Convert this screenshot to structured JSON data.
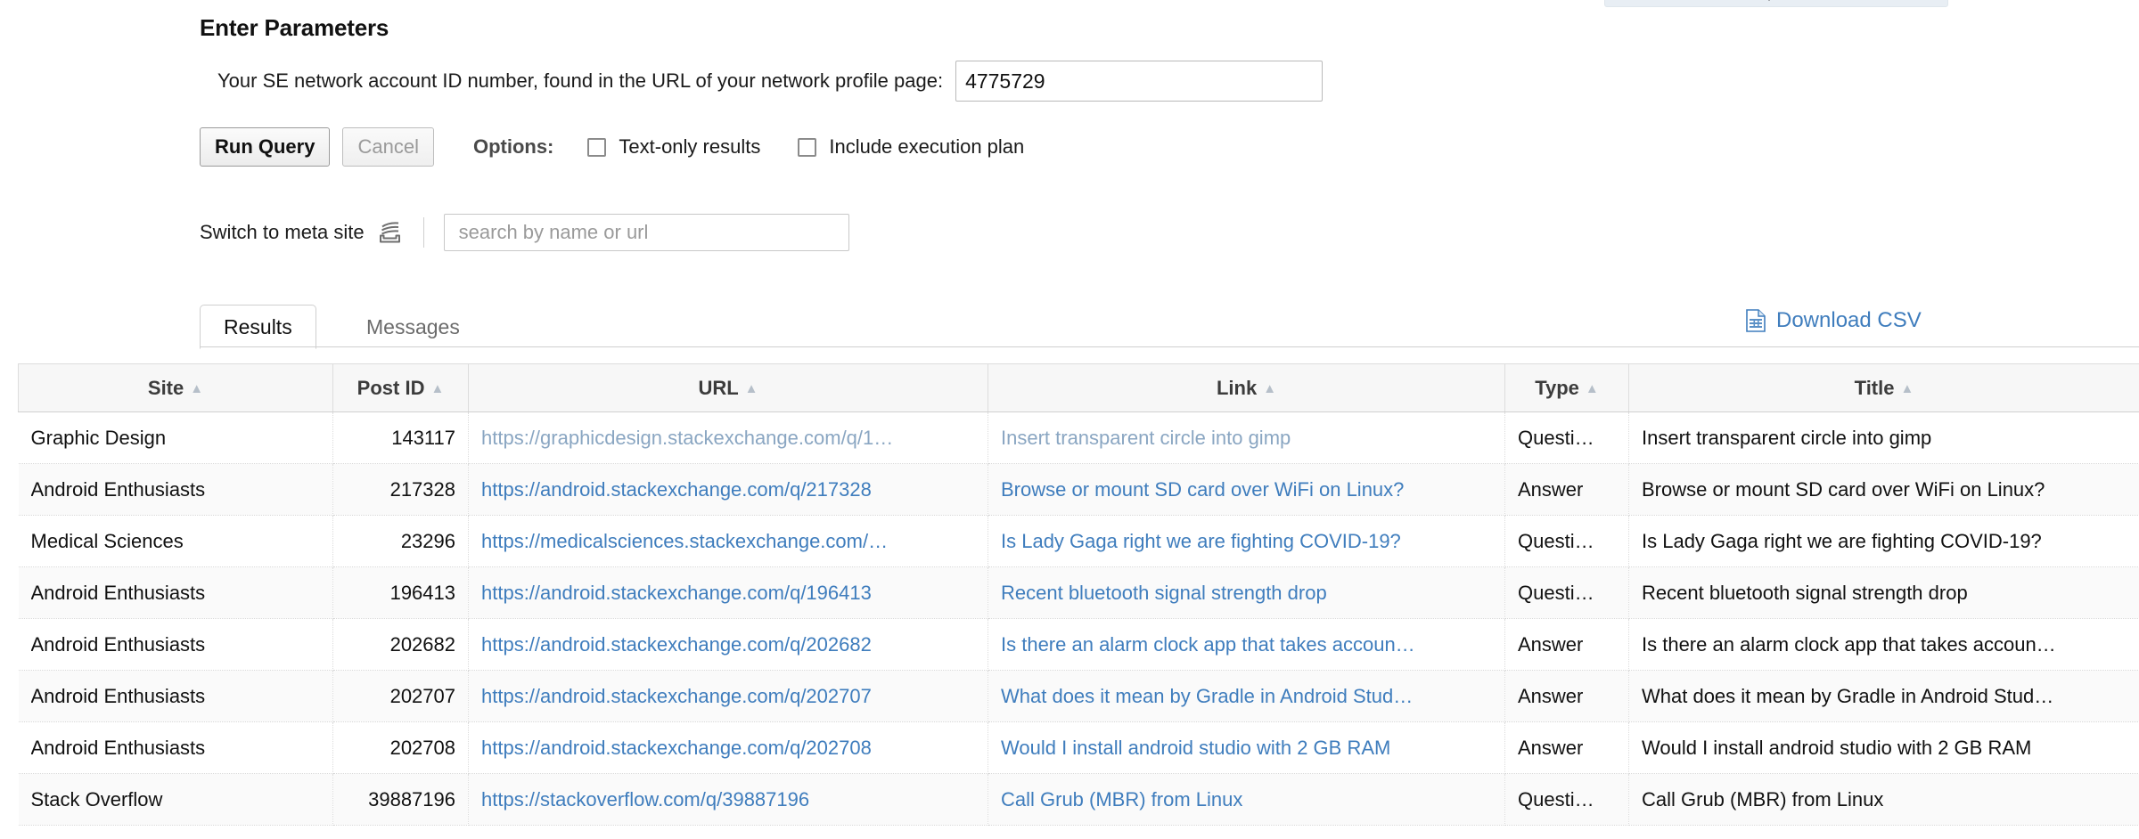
{
  "top_panel": {
    "icon": "check-glyph"
  },
  "form": {
    "heading": "Enter Parameters",
    "param_label": "Your SE network account ID number, found in the URL of your network profile page:",
    "param_value": "4775729",
    "param_placeholder": "",
    "run_label": "Run Query",
    "cancel_label": "Cancel",
    "options_label": "Options:",
    "option_text_only": "Text-only results",
    "option_exec_plan": "Include execution plan"
  },
  "meta": {
    "switch_label": "Switch to meta site",
    "icon": "stack-exchange-icon",
    "search_placeholder": "search by name or url",
    "search_value": ""
  },
  "tabs": {
    "items": [
      {
        "label": "Results",
        "active": true
      },
      {
        "label": "Messages",
        "active": false
      }
    ],
    "download_label": "Download CSV",
    "download_icon": "csv-file-icon"
  },
  "table": {
    "columns": [
      {
        "label": "Site",
        "sort": "▲"
      },
      {
        "label": "Post ID",
        "sort": "▲"
      },
      {
        "label": "URL",
        "sort": "▲"
      },
      {
        "label": "Link",
        "sort": "▲"
      },
      {
        "label": "Type",
        "sort": "▲"
      },
      {
        "label": "Title",
        "sort": "▲"
      }
    ],
    "rows": [
      {
        "site": "Graphic Design",
        "post_id": "143117",
        "url": "https://graphicdesign.stackexchange.com/q/1…",
        "url_visited": true,
        "link": "Insert transparent circle into gimp",
        "link_visited": true,
        "type": "Questi…",
        "title": "Insert transparent circle into gimp"
      },
      {
        "site": "Android Enthusiasts",
        "post_id": "217328",
        "url": "https://android.stackexchange.com/q/217328",
        "url_visited": false,
        "link": "Browse or mount SD card over WiFi on Linux?",
        "link_visited": false,
        "type": "Answer",
        "title": "Browse or mount SD card over WiFi on Linux?"
      },
      {
        "site": "Medical Sciences",
        "post_id": "23296",
        "url": "https://medicalsciences.stackexchange.com/…",
        "url_visited": false,
        "link": "Is Lady Gaga right we are fighting COVID-19?",
        "link_visited": false,
        "type": "Questi…",
        "title": "Is Lady Gaga right we are fighting COVID-19?"
      },
      {
        "site": "Android Enthusiasts",
        "post_id": "196413",
        "url": "https://android.stackexchange.com/q/196413",
        "url_visited": false,
        "link": "Recent bluetooth signal strength drop",
        "link_visited": false,
        "type": "Questi…",
        "title": "Recent bluetooth signal strength drop"
      },
      {
        "site": "Android Enthusiasts",
        "post_id": "202682",
        "url": "https://android.stackexchange.com/q/202682",
        "url_visited": false,
        "link": "Is there an alarm clock app that takes accoun…",
        "link_visited": false,
        "type": "Answer",
        "title": "Is there an alarm clock app that takes accoun…"
      },
      {
        "site": "Android Enthusiasts",
        "post_id": "202707",
        "url": "https://android.stackexchange.com/q/202707",
        "url_visited": false,
        "link": "What does it mean by Gradle in Android Stud…",
        "link_visited": false,
        "type": "Answer",
        "title": "What does it mean by Gradle in Android Stud…"
      },
      {
        "site": "Android Enthusiasts",
        "post_id": "202708",
        "url": "https://android.stackexchange.com/q/202708",
        "url_visited": false,
        "link": "Would I install android studio with 2 GB RAM",
        "link_visited": false,
        "type": "Answer",
        "title": "Would I install android studio with 2 GB RAM"
      },
      {
        "site": "Stack Overflow",
        "post_id": "39887196",
        "url": "https://stackoverflow.com/q/39887196",
        "url_visited": false,
        "link": "Call Grub (MBR) from Linux",
        "link_visited": false,
        "type": "Questi…",
        "title": "Call Grub (MBR) from Linux"
      }
    ]
  },
  "colors": {
    "link": "#3f7dbd",
    "link_visited": "#8aa6c2",
    "header_bg": "#f7f7f7",
    "panel_bg": "#e8eef4"
  }
}
